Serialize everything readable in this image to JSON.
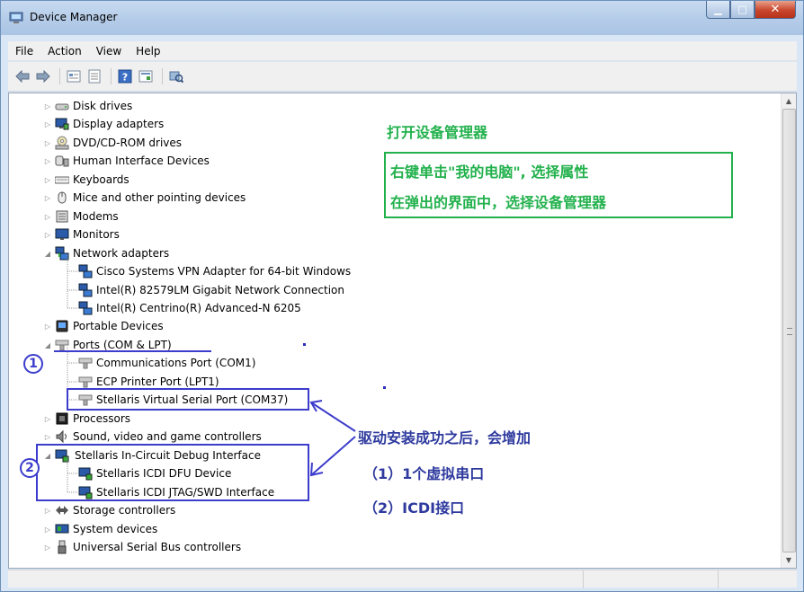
{
  "window": {
    "title": "Device Manager"
  },
  "menu": [
    "File",
    "Action",
    "View",
    "Help"
  ],
  "toolbar": {
    "buttons": [
      "back-arrow-icon",
      "forward-arrow-icon",
      "properties-icon",
      "show-hidden-icon",
      "help-icon",
      "details-icon",
      "scan-hardware-icon"
    ]
  },
  "tree": {
    "disk_drives": "Disk drives",
    "display_adapters": "Display adapters",
    "dvd_drives": "DVD/CD-ROM drives",
    "hid": "Human Interface Devices",
    "keyboards": "Keyboards",
    "mice": "Mice and other pointing devices",
    "modems": "Modems",
    "monitors": "Monitors",
    "network_adapters": "Network adapters",
    "net_cisco": "Cisco Systems VPN Adapter for 64-bit Windows",
    "net_intel_gbe": "Intel(R) 82579LM Gigabit Network Connection",
    "net_intel_wifi": "Intel(R) Centrino(R) Advanced-N 6205",
    "portable_devices": "Portable Devices",
    "ports": "Ports (COM & LPT)",
    "port_com1": "Communications Port (COM1)",
    "port_lpt1": "ECP Printer Port (LPT1)",
    "port_stellaris": "Stellaris Virtual Serial Port (COM37)",
    "processors": "Processors",
    "sound": "Sound, video and game controllers",
    "stellaris_icdi": "Stellaris In-Circuit Debug Interface",
    "icdi_dfu": "Stellaris ICDI DFU Device",
    "icdi_jtag": "Stellaris ICDI JTAG/SWD Interface",
    "storage": "Storage controllers",
    "system": "System devices",
    "usb": "Universal Serial Bus controllers"
  },
  "annotations": {
    "green_title": "打开设备管理器",
    "green_line1": "右键单击\"我的电脑\", 选择属性",
    "green_line2": "在弹出的界面中，选择设备管理器",
    "blue_line1": "驱动安装成功之后，会增加",
    "blue_line2": "（1）1个虚拟串口",
    "blue_line3": "（2）ICDI接口",
    "circle_1": "1",
    "circle_2": "2",
    "accent_green": "#22b14c",
    "accent_blue": "#3c3ccd"
  }
}
